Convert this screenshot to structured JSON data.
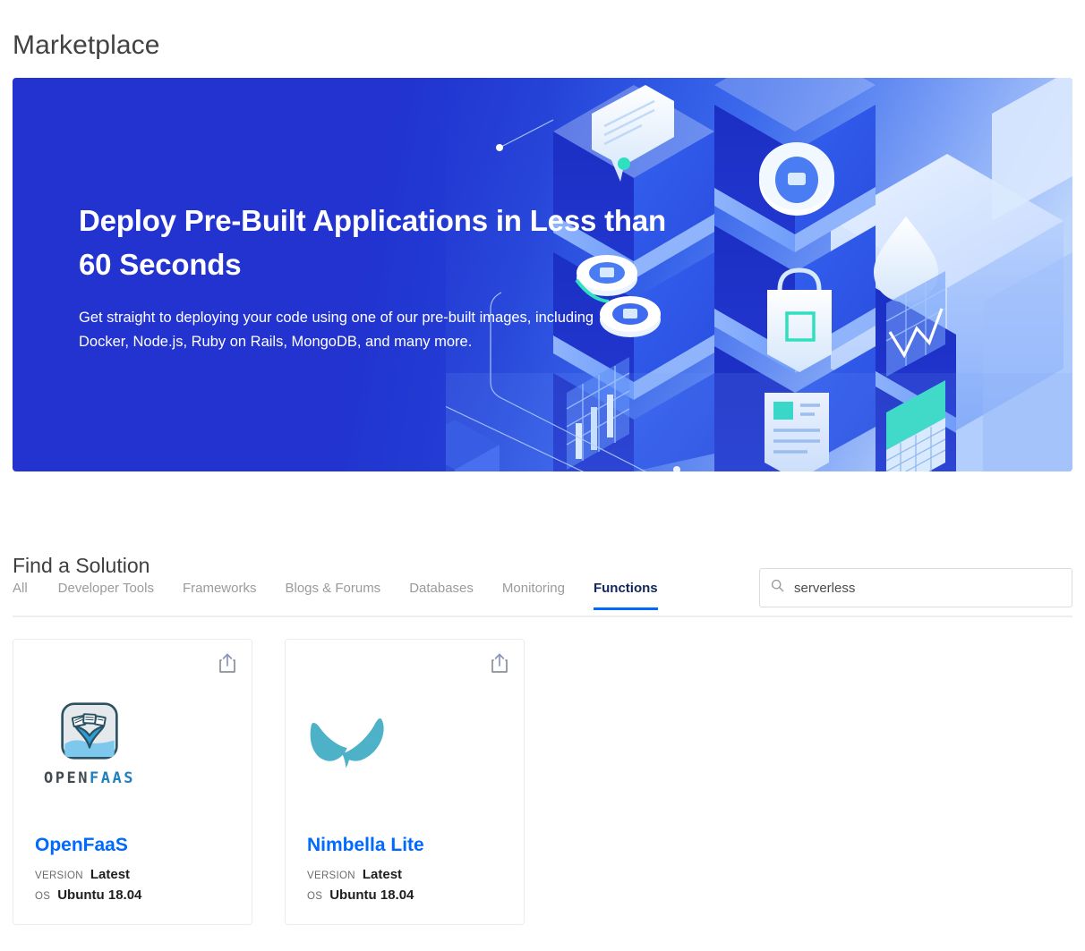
{
  "page": {
    "title": "Marketplace"
  },
  "hero": {
    "heading": "Deploy Pre-Built Applications in Less than 60 Seconds",
    "subheading": "Get straight to deploying your code using one of our pre-built images, including Docker, Node.js, Ruby on Rails, MongoDB, and many more.",
    "bg_start_color": "#2233cf",
    "bg_end_color": "#cfe0fe"
  },
  "find": {
    "heading": "Find a Solution"
  },
  "tabs": {
    "active": "Functions",
    "items": [
      {
        "label": "All",
        "active": false
      },
      {
        "label": "Developer Tools",
        "active": false
      },
      {
        "label": "Frameworks",
        "active": false
      },
      {
        "label": "Blogs & Forums",
        "active": false
      },
      {
        "label": "Databases",
        "active": false
      },
      {
        "label": "Monitoring",
        "active": false
      },
      {
        "label": "Functions",
        "active": true
      }
    ],
    "active_color": "#0069ff",
    "inactive_color": "#9b9b9b"
  },
  "search": {
    "value": "serverless",
    "placeholder": "Search",
    "icon": "search-icon"
  },
  "cards": [
    {
      "name": "OpenFaaS",
      "logo": "openfaas-logo",
      "logo_wordmark_dark": "OPEN",
      "logo_wordmark_accent": "FAAS",
      "share_icon": "share-icon",
      "meta": [
        {
          "key": "VERSION",
          "value": "Latest"
        },
        {
          "key": "OS",
          "value": "Ubuntu 18.04"
        }
      ]
    },
    {
      "name": "Nimbella Lite",
      "logo": "nimbella-butterfly-logo",
      "logo_color": "#4db2c8",
      "share_icon": "share-icon",
      "meta": [
        {
          "key": "VERSION",
          "value": "Latest"
        },
        {
          "key": "OS",
          "value": "Ubuntu 18.04"
        }
      ]
    }
  ]
}
